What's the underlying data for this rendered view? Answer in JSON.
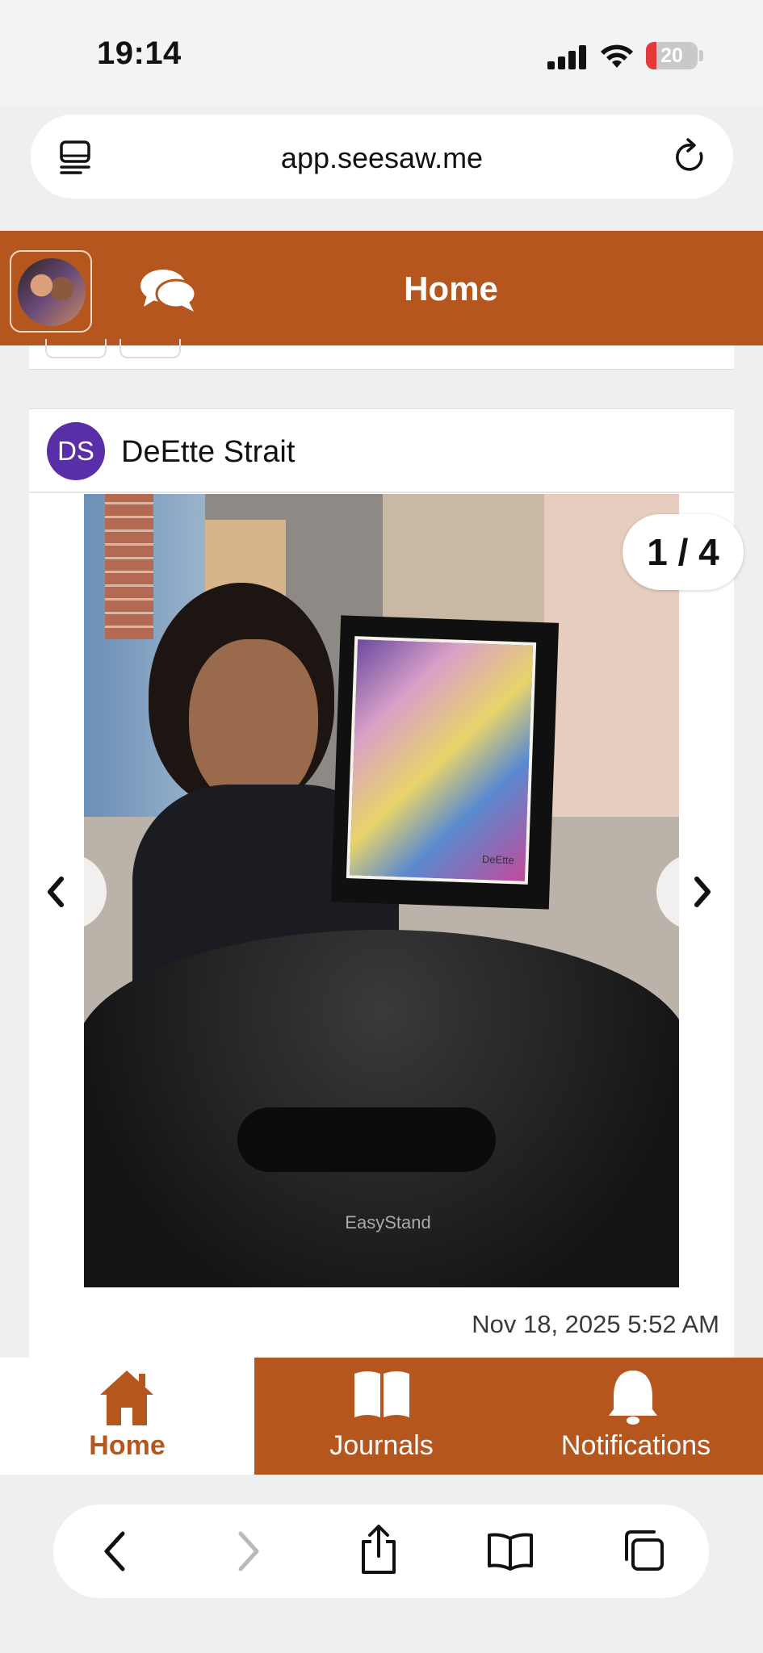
{
  "status_bar": {
    "time": "19:14",
    "battery_level": "20",
    "battery_fraction": 0.2,
    "battery_color": "#e5383b"
  },
  "browser": {
    "url": "app.seesaw.me",
    "icons": [
      "tabs-icon",
      "reload-icon"
    ]
  },
  "app_header": {
    "title": "Home",
    "icons": [
      "profile-avatar",
      "chat-bubbles-icon"
    ],
    "brand_color": "#b5561f"
  },
  "post": {
    "author_initials": "DS",
    "author_name": "DeEtte Strait",
    "author_avatar_color": "#5a2ea6",
    "pager": "1 / 4",
    "photo_caption_text": "EasyStand",
    "artwork_signature": "DeEtte",
    "date": "Nov 18, 2025 5:52 AM"
  },
  "tab_bar": {
    "tabs": [
      {
        "label": "Home",
        "icon": "house-icon",
        "active": true
      },
      {
        "label": "Journals",
        "icon": "book-icon",
        "active": false
      },
      {
        "label": "Notifications",
        "icon": "bell-icon",
        "active": false
      }
    ]
  },
  "safari_toolbar": {
    "icons": [
      "back-icon",
      "forward-icon",
      "share-icon",
      "bookmarks-icon",
      "tabs-overview-icon"
    ]
  }
}
